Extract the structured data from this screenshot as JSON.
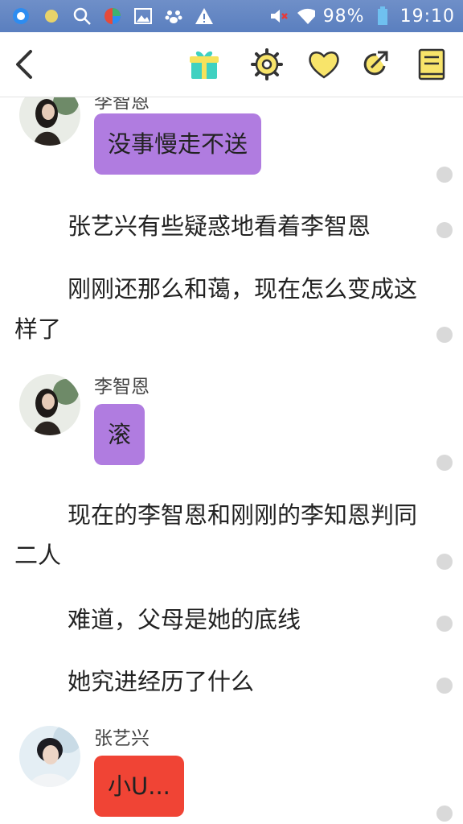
{
  "status_bar": {
    "battery": "98%",
    "time": "19:10"
  },
  "toolbar": {
    "back_icon": "chevron-left-icon",
    "gift_icon": "gift-icon",
    "settings_icon": "gear-icon",
    "like_icon": "heart-icon",
    "share_icon": "share-icon",
    "catalog_icon": "book-icon"
  },
  "colors": {
    "accent_yellow": "#f8e46a",
    "bubble_purple": "#b07ce0",
    "bubble_red": "#f04435",
    "statusbar_blue": "#5a7fbf"
  },
  "messages": [
    {
      "speaker": "李智恩",
      "text": "没事慢走不送"
    },
    {
      "narration": "张艺兴有些疑惑地看着李智恩"
    },
    {
      "narration": "刚刚还那么和蔼，现在怎么变成这样了"
    },
    {
      "speaker": "李智恩",
      "text": "滚"
    },
    {
      "narration": "现在的李智恩和刚刚的李知恩判同二人"
    },
    {
      "narration": "难道，父母是她的底线"
    },
    {
      "narration": "她究进经历了什么"
    },
    {
      "speaker": "张艺兴",
      "text": "小U..."
    }
  ]
}
